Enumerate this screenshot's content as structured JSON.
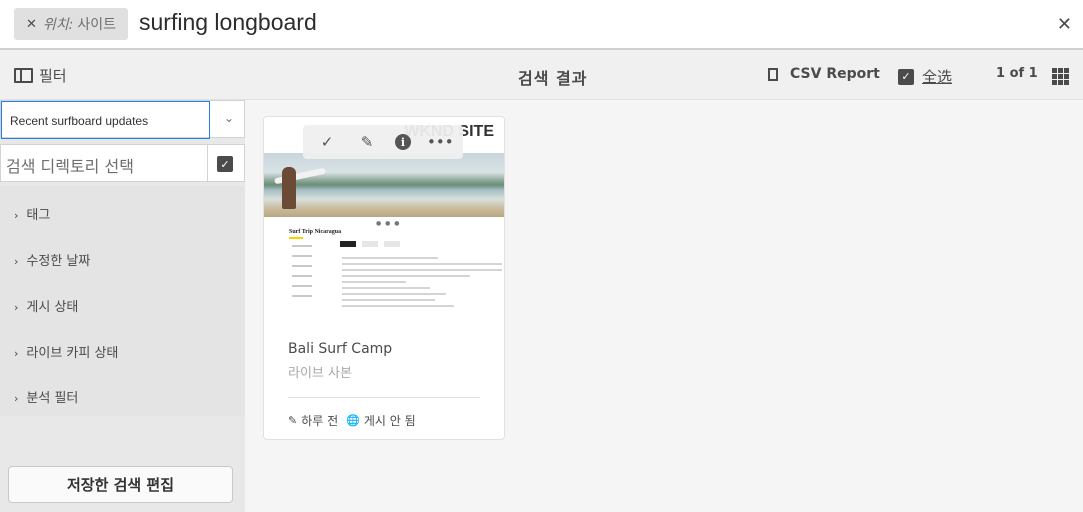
{
  "search": {
    "location_label": "위치:",
    "location_value": "사이트",
    "query": "surfing longboard"
  },
  "toolbar": {
    "filter_label": "필터",
    "title": "검색 결과",
    "csv_label": "CSV Report",
    "select_all_label": "全选",
    "count": "1 of 1"
  },
  "sidebar": {
    "saved_search": "Recent surfboard updates",
    "directory_label": "검색 디렉토리 선택",
    "facets": [
      "태그",
      "수정한 날짜",
      "게시 상태",
      "라이브 카피 상태",
      "분석 필터"
    ],
    "edit_button": "저장한 검색 편집"
  },
  "card": {
    "brand": "WKND SITE",
    "page_title": "Surf Trip Nicaragua",
    "title": "Bali Surf Camp",
    "subtitle": "라이브 사본",
    "modified": "하루 전",
    "status": "게시 안 됨"
  }
}
